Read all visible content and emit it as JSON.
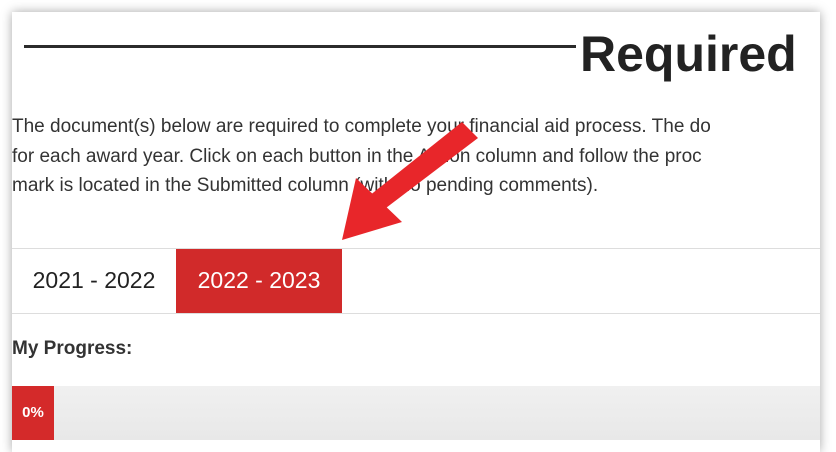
{
  "page": {
    "title": "Required",
    "intro_lines": [
      "The document(s) below are required to complete your financial aid process. The do",
      "for each award year. Click on each button in the Action column and follow the proc",
      "mark is located in the Submitted column (with no pending comments)."
    ]
  },
  "tabs": [
    {
      "label": "2021 - 2022",
      "active": false
    },
    {
      "label": "2022 - 2023",
      "active": true
    }
  ],
  "progress": {
    "label": "My Progress:",
    "value_text": "0%",
    "fraction": 0
  },
  "colors": {
    "accent": "#d12a2a",
    "arrow": "#e8262a"
  },
  "annotation": {
    "type": "arrow",
    "points_to": "tab-2022-2023"
  }
}
